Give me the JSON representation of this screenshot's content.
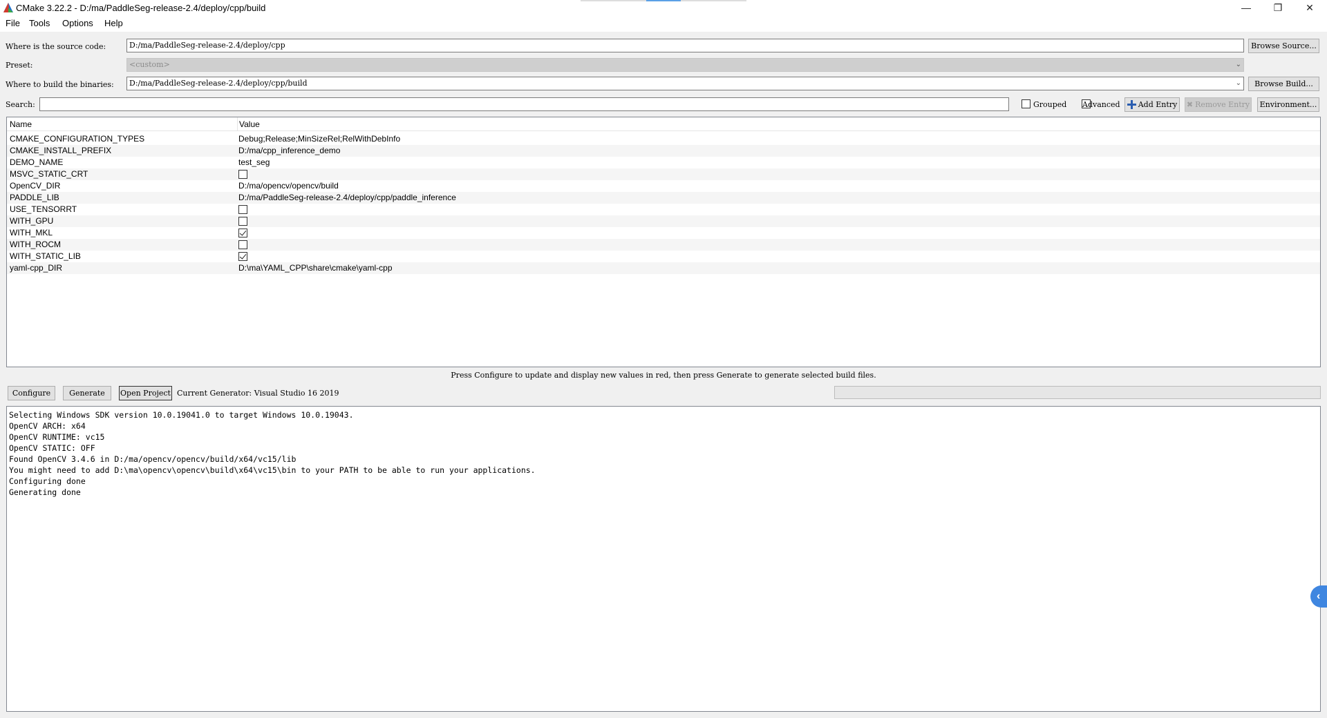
{
  "window": {
    "title": "CMake 3.22.2 - D:/ma/PaddleSeg-release-2.4/deploy/cpp/build",
    "minimize_glyph": "—",
    "restore_glyph": "❐",
    "close_glyph": "✕"
  },
  "menu": [
    "File",
    "Tools",
    "Options",
    "Help"
  ],
  "source": {
    "label": "Where is the source code:",
    "value": "D:/ma/PaddleSeg-release-2.4/deploy/cpp",
    "button": "Browse Source..."
  },
  "preset": {
    "label": "Preset:",
    "value": "<custom>"
  },
  "binaries": {
    "label": "Where to build the binaries:",
    "value": "D:/ma/PaddleSeg-release-2.4/deploy/cpp/build",
    "button": "Browse Build..."
  },
  "search": {
    "label": "Search:",
    "value": ""
  },
  "options": {
    "grouped": {
      "label": "Grouped",
      "checked": false
    },
    "advanced": {
      "label": "Advanced",
      "checked": false
    },
    "add_entry": "Add Entry",
    "remove_entry": "Remove Entry",
    "environment": "Environment..."
  },
  "table": {
    "headers": [
      "Name",
      "Value"
    ],
    "rows": [
      {
        "name": "CMAKE_CONFIGURATION_TYPES",
        "value": "Debug;Release;MinSizeRel;RelWithDebInfo"
      },
      {
        "name": "CMAKE_INSTALL_PREFIX",
        "value": "D:/ma/cpp_inference_demo"
      },
      {
        "name": "DEMO_NAME",
        "value": "test_seg"
      },
      {
        "name": "MSVC_STATIC_CRT",
        "checked": false
      },
      {
        "name": "OpenCV_DIR",
        "value": "D:/ma/opencv/opencv/build"
      },
      {
        "name": "PADDLE_LIB",
        "value": "D:/ma/PaddleSeg-release-2.4/deploy/cpp/paddle_inference"
      },
      {
        "name": "USE_TENSORRT",
        "checked": false
      },
      {
        "name": "WITH_GPU",
        "checked": false
      },
      {
        "name": "WITH_MKL",
        "checked": true
      },
      {
        "name": "WITH_ROCM",
        "checked": false
      },
      {
        "name": "WITH_STATIC_LIB",
        "checked": true
      },
      {
        "name": "yaml-cpp_DIR",
        "value": "D:\\ma\\YAML_CPP\\share\\cmake\\yaml-cpp"
      }
    ]
  },
  "hint": "Press Configure to update and display new values in red,  then press Generate to generate selected build files.",
  "actions": {
    "configure": "Configure",
    "generate": "Generate",
    "open_project": "Open Project",
    "generator": "Current Generator: Visual Studio 16 2019"
  },
  "output": [
    "Selecting Windows SDK version 10.0.19041.0 to target Windows 10.0.19043.",
    "OpenCV ARCH: x64",
    "OpenCV RUNTIME: vc15",
    "OpenCV STATIC: OFF",
    "Found OpenCV 3.4.6 in D:/ma/opencv/opencv/build/x64/vc15/lib",
    "You might need to add D:\\ma\\opencv\\opencv\\build\\x64\\vc15\\bin to your PATH to be able to run your applications.",
    "Configuring done",
    "Generating done"
  ],
  "colors": {
    "accent": "#3f86e0",
    "add_icon": "#2a5db0"
  }
}
